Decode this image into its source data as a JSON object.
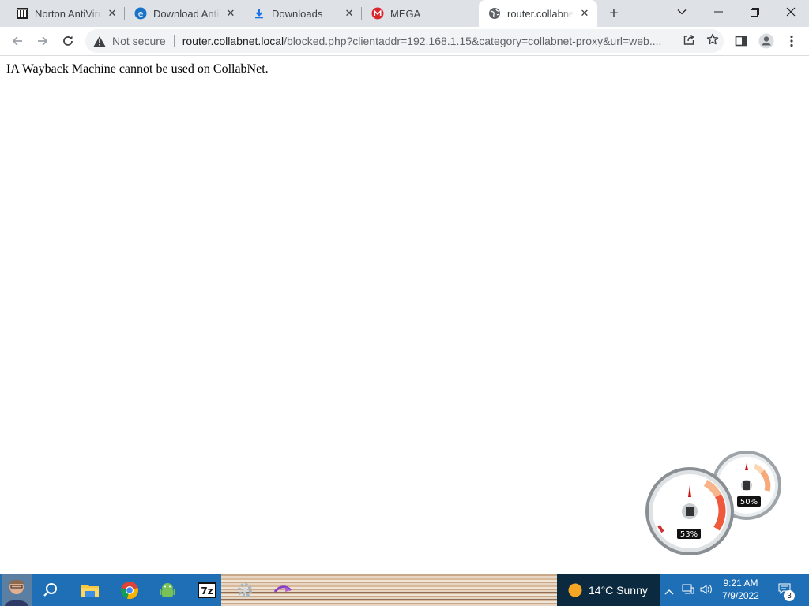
{
  "tabs": [
    {
      "title": "Norton AntiVirus",
      "icon": "library-icon",
      "active": false
    },
    {
      "title": "Download AntiVirus",
      "icon": "edge-e-icon",
      "active": false
    },
    {
      "title": "Downloads",
      "icon": "download-icon",
      "active": false
    },
    {
      "title": "MEGA",
      "icon": "mega-icon",
      "active": false
    },
    {
      "title": "router.collabnet.local",
      "icon": "globe-icon",
      "active": true
    }
  ],
  "toolbar": {
    "security_label": "Not secure",
    "url_host": "router.collabnet.local",
    "url_rest": "/blocked.php?clientaddr=192.168.1.15&category=collabnet-proxy&url=web...."
  },
  "page": {
    "message": "IA Wayback Machine cannot be used on CollabNet."
  },
  "gadget": {
    "cpu_percent_label": "53%",
    "memory_percent_label": "50%",
    "cpu_percent": 53,
    "memory_percent": 50
  },
  "taskbar": {
    "weather": "14°C  Sunny",
    "time": "9:21 AM",
    "date": "7/9/2022",
    "notification_count": "3"
  },
  "colors": {
    "tabstrip_bg": "#dee1e6",
    "omnibox_bg": "#f1f3f4",
    "taskbar_bg": "#1e6fb5",
    "mega_red": "#d9272e"
  }
}
